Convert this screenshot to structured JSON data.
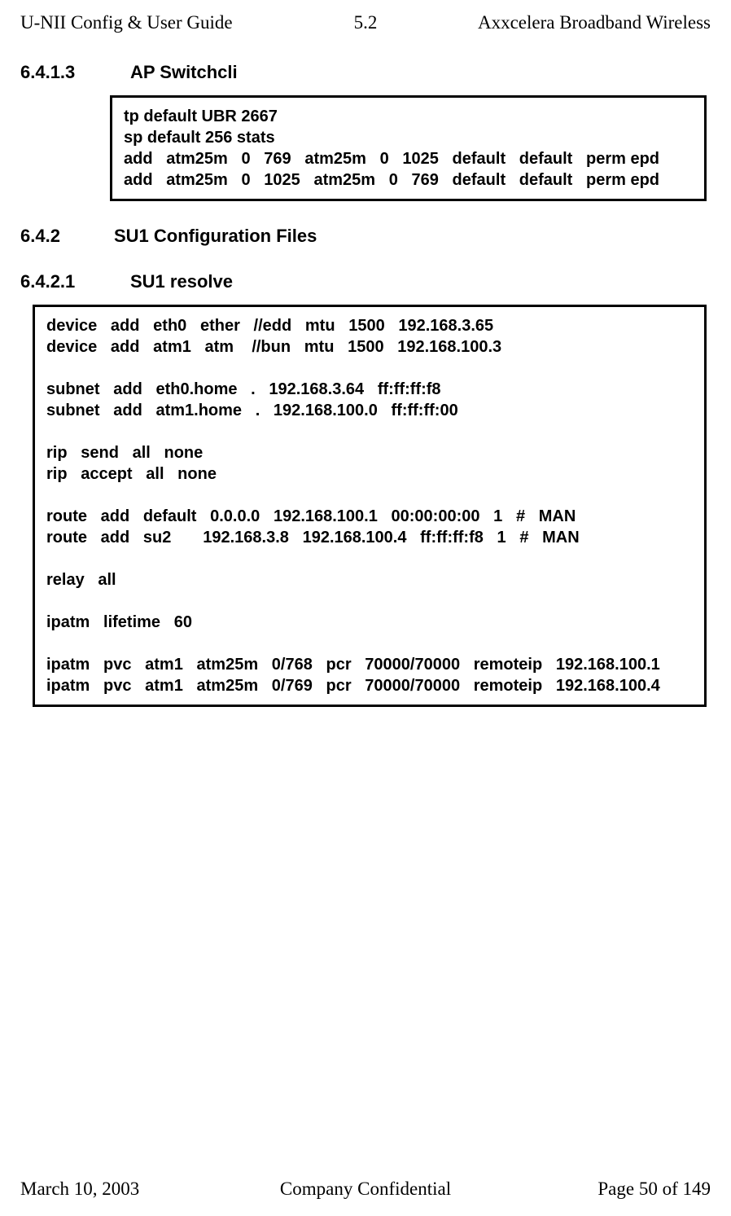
{
  "header": {
    "left": "U-NII Config & User Guide",
    "center": "5.2",
    "right": "Axxcelera Broadband Wireless"
  },
  "sections": {
    "s1_num": "6.4.1.3",
    "s1_title": "AP Switchcli",
    "s1_code": "tp default UBR 2667\nsp default 256 stats\nadd   atm25m   0   769   atm25m   0   1025   default   default   perm epd\nadd   atm25m   0   1025   atm25m   0   769   default   default   perm epd",
    "s2_num": "6.4.2",
    "s2_title": "SU1 Configuration Files",
    "s3_num": "6.4.2.1",
    "s3_title": "SU1 resolve",
    "s3_code": "device   add   eth0   ether   //edd   mtu   1500   192.168.3.65\ndevice   add   atm1   atm    //bun   mtu   1500   192.168.100.3\n\nsubnet   add   eth0.home   .   192.168.3.64   ff:ff:ff:f8\nsubnet   add   atm1.home   .   192.168.100.0   ff:ff:ff:00\n\nrip   send   all   none\nrip   accept   all   none\n\nroute   add   default   0.0.0.0   192.168.100.1   00:00:00:00   1   #   MAN\nroute   add   su2       192.168.3.8   192.168.100.4   ff:ff:ff:f8   1   #   MAN\n\nrelay   all\n\nipatm   lifetime   60\n\nipatm   pvc   atm1   atm25m   0/768   pcr   70000/70000   remoteip   192.168.100.1\nipatm   pvc   atm1   atm25m   0/769   pcr   70000/70000   remoteip   192.168.100.4"
  },
  "footer": {
    "left": "March 10, 2003",
    "center": "Company Confidential",
    "right": "Page 50 of 149"
  }
}
